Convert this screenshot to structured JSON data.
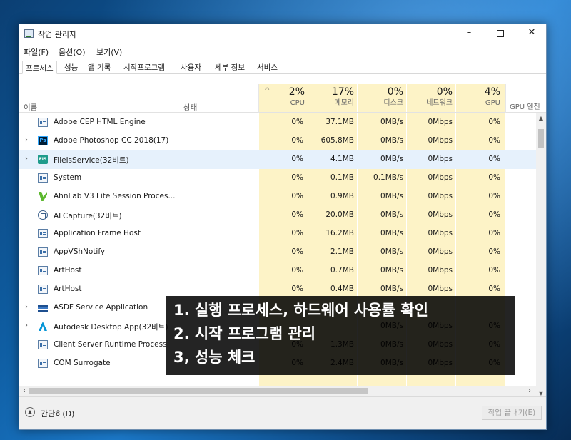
{
  "window": {
    "title": "작업 관리자",
    "controls": {
      "minimize": "–",
      "maximize": "",
      "close": "✕"
    }
  },
  "menu": [
    "파일(F)",
    "옵션(O)",
    "보기(V)"
  ],
  "tabs": [
    {
      "label": "프로세스",
      "active": true
    },
    {
      "label": "성능",
      "active": false
    },
    {
      "label": "앱 기록",
      "active": false
    },
    {
      "label": "시작프로그램",
      "active": false
    },
    {
      "label": "사용자",
      "active": false
    },
    {
      "label": "세부 정보",
      "active": false
    },
    {
      "label": "서비스",
      "active": false
    }
  ],
  "columns": {
    "name": "이름",
    "status": "상태",
    "sort_caret": "^",
    "cpu": {
      "percent": "2%",
      "label": "CPU"
    },
    "memory": {
      "percent": "17%",
      "label": "메모리"
    },
    "disk": {
      "percent": "0%",
      "label": "디스크"
    },
    "network": {
      "percent": "0%",
      "label": "네트워크"
    },
    "gpu": {
      "percent": "4%",
      "label": "GPU"
    },
    "gpu_engine": "GPU 엔진"
  },
  "processes": [
    {
      "name": "Adobe CEP HTML Engine",
      "icon": "generic-app-icon",
      "expandable": false,
      "cpu": "0%",
      "memory": "37.1MB",
      "disk": "0MB/s",
      "network": "0Mbps",
      "gpu": "0%"
    },
    {
      "name": "Adobe Photoshop CC 2018(17)",
      "icon": "photoshop-icon",
      "icon_text": "Ps",
      "expandable": true,
      "cpu": "0%",
      "memory": "605.8MB",
      "disk": "0MB/s",
      "network": "0Mbps",
      "gpu": "0%"
    },
    {
      "name": "FileisService(32비트)",
      "icon": "fileis-icon",
      "icon_text": "FIS",
      "expandable": true,
      "selected": true,
      "cpu": "0%",
      "memory": "4.1MB",
      "disk": "0MB/s",
      "network": "0Mbps",
      "gpu": "0%"
    },
    {
      "name": "System",
      "icon": "generic-app-icon",
      "expandable": false,
      "cpu": "0%",
      "memory": "0.1MB",
      "disk": "0.1MB/s",
      "network": "0Mbps",
      "gpu": "0%"
    },
    {
      "name": "AhnLab V3 Lite Session Proces...",
      "icon": "ahnlab-icon",
      "expandable": false,
      "cpu": "0%",
      "memory": "0.9MB",
      "disk": "0MB/s",
      "network": "0Mbps",
      "gpu": "0%"
    },
    {
      "name": "ALCapture(32비트)",
      "icon": "alcapture-icon",
      "expandable": false,
      "cpu": "0%",
      "memory": "20.0MB",
      "disk": "0MB/s",
      "network": "0Mbps",
      "gpu": "0%"
    },
    {
      "name": "Application Frame Host",
      "icon": "generic-app-icon",
      "expandable": false,
      "cpu": "0%",
      "memory": "16.2MB",
      "disk": "0MB/s",
      "network": "0Mbps",
      "gpu": "0%"
    },
    {
      "name": "AppVShNotify",
      "icon": "generic-app-icon",
      "expandable": false,
      "cpu": "0%",
      "memory": "2.1MB",
      "disk": "0MB/s",
      "network": "0Mbps",
      "gpu": "0%"
    },
    {
      "name": "ArtHost",
      "icon": "generic-app-icon",
      "expandable": false,
      "cpu": "0%",
      "memory": "0.7MB",
      "disk": "0MB/s",
      "network": "0Mbps",
      "gpu": "0%"
    },
    {
      "name": "ArtHost",
      "icon": "generic-app-icon",
      "expandable": false,
      "cpu": "0%",
      "memory": "0.4MB",
      "disk": "0MB/s",
      "network": "0Mbps",
      "gpu": "0%"
    },
    {
      "name": "ASDF Service Application",
      "icon": "asdf-icon",
      "expandable": true,
      "cpu": "",
      "memory": "",
      "disk": "",
      "network": "",
      "gpu": ""
    },
    {
      "name": "Autodesk Desktop App(32비트)",
      "icon": "autodesk-icon",
      "expandable": true,
      "cpu": "",
      "memory": "",
      "disk": "0MB/s",
      "network": "0Mbps",
      "gpu": "0%"
    },
    {
      "name": "Client Server Runtime Process",
      "icon": "generic-app-icon",
      "expandable": false,
      "cpu": "0%",
      "memory": "1.3MB",
      "disk": "0MB/s",
      "network": "0Mbps",
      "gpu": "0%"
    },
    {
      "name": "COM Surrogate",
      "icon": "generic-app-icon",
      "expandable": false,
      "cpu": "0%",
      "memory": "2.4MB",
      "disk": "0MB/s",
      "network": "0Mbps",
      "gpu": "0%"
    }
  ],
  "footer": {
    "fewer_details": "간단히(D)",
    "end_task": "작업 끝내기(E)"
  },
  "overlay": {
    "lines": [
      "1. 실행 프로세스, 하드웨어 사용률 확인",
      "2. 시작 프로그램 관리",
      "3, 성능 체크"
    ]
  },
  "colors": {
    "column_shade": "#fdf3c7",
    "selected_row": "#e6f1fc",
    "overlay_bg": "#000000"
  }
}
